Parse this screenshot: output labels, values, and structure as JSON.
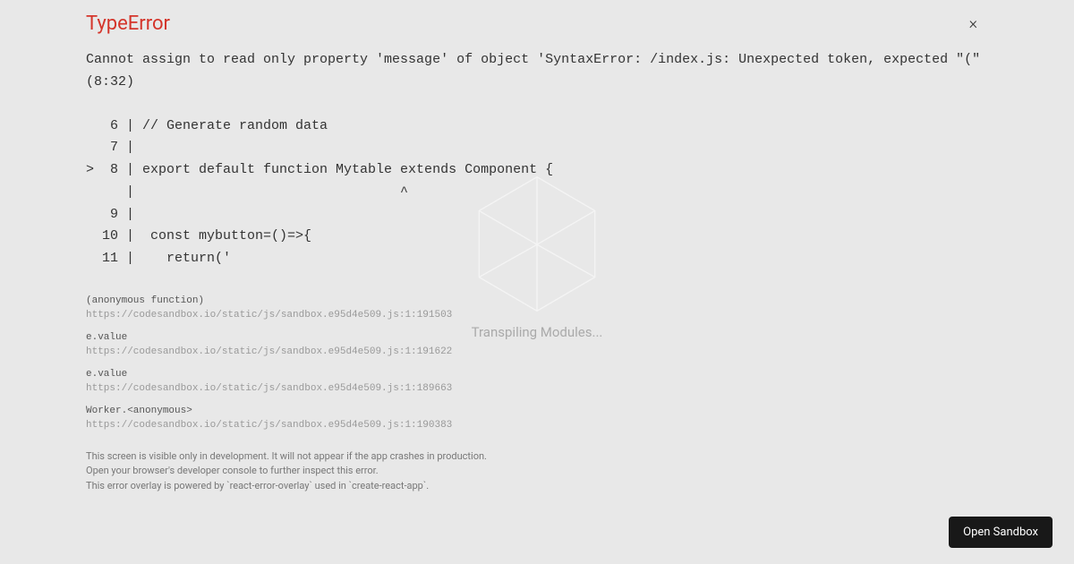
{
  "background": {
    "loading_text": "Transpiling Modules..."
  },
  "error": {
    "title": "TypeError",
    "close_symbol": "×",
    "message": "Cannot assign to read only property 'message' of object 'SyntaxError: /index.js: Unexpected token, expected \"(\" (8:32)",
    "code_frame": "   6 | // Generate random data\n   7 | \n>  8 | export default function Mytable extends Component {\n     |                                 ^\n   9 | \n  10 |  const mybutton=()=>{\n  11 |    return('",
    "stack": [
      {
        "fn": "(anonymous function)",
        "loc": "https://codesandbox.io/static/js/sandbox.e95d4e509.js:1:191503"
      },
      {
        "fn": "e.value",
        "loc": "https://codesandbox.io/static/js/sandbox.e95d4e509.js:1:191622"
      },
      {
        "fn": "e.value",
        "loc": "https://codesandbox.io/static/js/sandbox.e95d4e509.js:1:189663"
      },
      {
        "fn": "Worker.<anonymous>",
        "loc": "https://codesandbox.io/static/js/sandbox.e95d4e509.js:1:190383"
      }
    ],
    "footer": {
      "line1": "This screen is visible only in development. It will not appear if the app crashes in production.",
      "line2": "Open your browser's developer console to further inspect this error.",
      "line3": "This error overlay is powered by `react-error-overlay` used in `create-react-app`."
    }
  },
  "actions": {
    "open_sandbox_label": "Open Sandbox"
  }
}
